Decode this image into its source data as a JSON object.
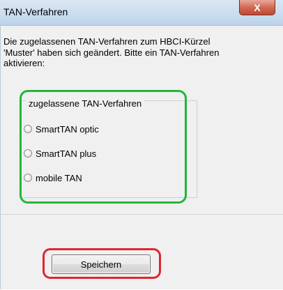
{
  "window": {
    "title": "TAN-Verfahren",
    "close_label": "X"
  },
  "message": {
    "text": "Die zugelassenen TAN-Verfahren zum HBCI-Kürzel\n'Muster' haben sich geändert. Bitte ein TAN-Verfahren\naktivieren:"
  },
  "group": {
    "legend": "zugelassene TAN-Verfahren",
    "options": [
      {
        "label": "SmartTAN optic",
        "selected": false
      },
      {
        "label": "SmartTAN plus",
        "selected": false
      },
      {
        "label": "mobile TAN",
        "selected": false
      }
    ]
  },
  "buttons": {
    "save_label": "Speichern"
  },
  "colors": {
    "group_highlight": "#21b63b",
    "save_highlight": "#e0262d"
  }
}
